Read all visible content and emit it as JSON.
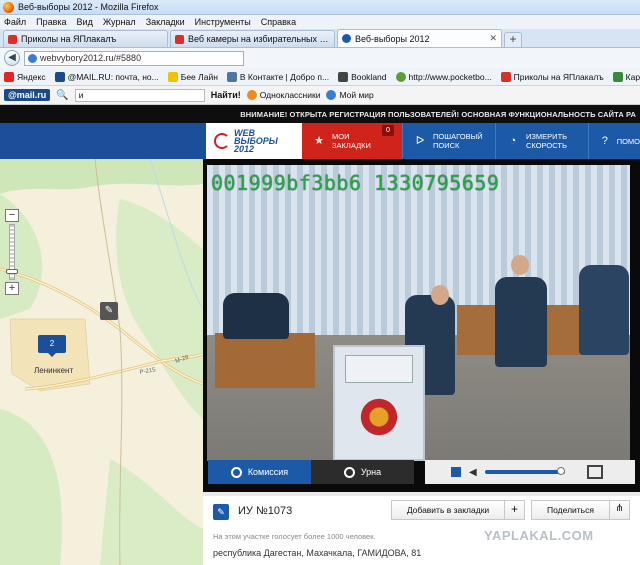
{
  "window": {
    "title": "Веб-выборы 2012 - Mozilla Firefox"
  },
  "menu": [
    "Файл",
    "Правка",
    "Вид",
    "Журнал",
    "Закладки",
    "Инструменты",
    "Справка"
  ],
  "tabs": [
    {
      "label": "Приколы на ЯПлакалъ",
      "color": "#d9302a"
    },
    {
      "label": "Веб камеры на избирательных учас...",
      "color": "#d9302a"
    },
    {
      "label": "Веб-выборы 2012",
      "color": "#1c5aa8"
    }
  ],
  "nav": {
    "url": "webvybory2012.ru/#5880"
  },
  "bookmarks": [
    {
      "label": "Яндекс",
      "icon": "yandex-icon",
      "color": "#e52620"
    },
    {
      "label": "@MAIL.RU: почта, но...",
      "icon": "mailru-icon",
      "color": "#1a4a8a"
    },
    {
      "label": "Бее Лайн",
      "icon": "beeline-icon",
      "color": "#f2c200"
    },
    {
      "label": "В Контакте | Добро п...",
      "icon": "vk-icon",
      "color": "#4c75a3"
    },
    {
      "label": "Bookland",
      "icon": "bookland-icon",
      "color": "#444"
    },
    {
      "label": "http://www.pocketbo...",
      "icon": "globe-icon",
      "color": "#5a9e3a"
    },
    {
      "label": "Приколы на ЯПлакалъ",
      "icon": "yaplakal-icon",
      "color": "#d9302a"
    },
    {
      "label": "Карты Google",
      "icon": "google-maps-icon",
      "color": "#3a8a3a"
    }
  ],
  "mailbar": {
    "logo": "@mail.ru",
    "search_value": "и",
    "find_label": "Найти!",
    "odnoklassniki": "Одноклассники",
    "moy_mir": "Мой мир"
  },
  "notice": "ВНИМАНИЕ! ОТКРЫТА РЕГИСТРАЦИЯ ПОЛЬЗОВАТЕЛЕЙ! ОСНОВНАЯ ФУНКЦИОНАЛЬНОСТЬ САЙТА РА",
  "header": {
    "brand_line1": "WEB",
    "brand_line2": "ВЫБОРЫ",
    "brand_line3": "2012",
    "bookmarks_line1": "МОИ",
    "bookmarks_line2": "ЗАКЛАДКИ",
    "bookmarks_count": "0",
    "search_line1": "ПОШАГОВЫЙ",
    "search_line2": "ПОИСК",
    "speed_line1": "ИЗМЕРИТЬ",
    "speed_line2": "СКОРОСТЬ",
    "help_line1": "ПОМО"
  },
  "map": {
    "marker_count": "2",
    "place_label": "Ленинкент",
    "road_labels": [
      "М-29",
      "Р-215"
    ]
  },
  "video": {
    "overlay_id": "001999bf3bb6 1330795659",
    "cam1": "Комиссия",
    "cam2": "Урна",
    "volume": 0.95
  },
  "info": {
    "uik": "ИУ №1073",
    "add_bookmark": "Добавить в закладки",
    "share": "Поделиться",
    "note": "На этом участке голосует более 1000 человек.",
    "address": "республика Дагестан, Махачкала, ГАМИДОВА, 81"
  },
  "watermark": "YAPLAKAL.COM"
}
